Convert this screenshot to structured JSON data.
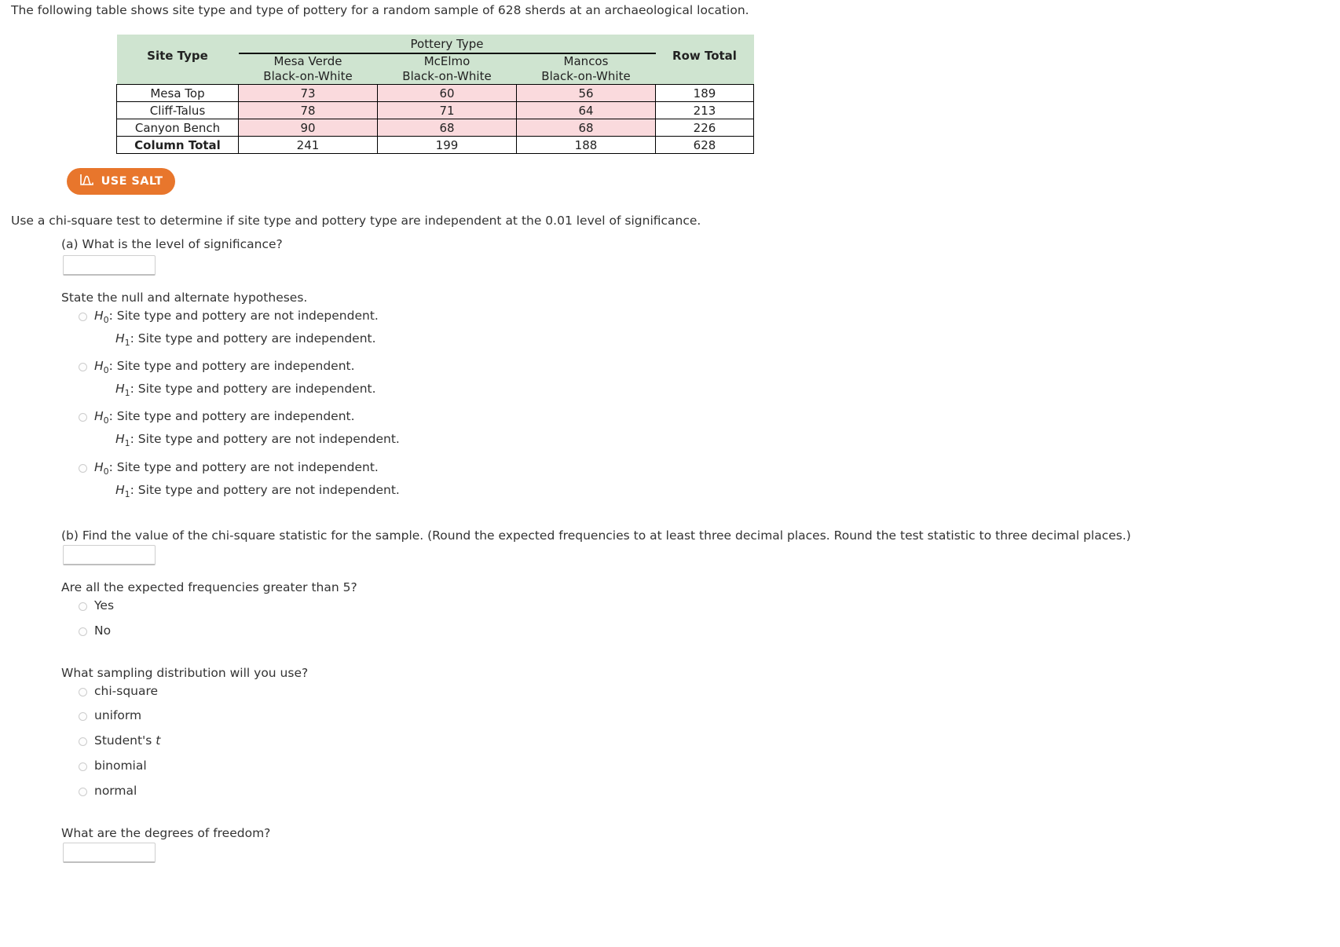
{
  "intro": "The following table shows site type and type of pottery for a random sample of 628 sherds at an archaeological location.",
  "table": {
    "super_header": "Pottery Type",
    "site_type_header": "Site Type",
    "row_total_header": "Row Total",
    "column_headers": [
      {
        "line1": "Mesa Verde",
        "line2": "Black-on-White"
      },
      {
        "line1": "McElmo",
        "line2": "Black-on-White"
      },
      {
        "line1": "Mancos",
        "line2": "Black-on-White"
      }
    ],
    "rows": [
      {
        "label": "Mesa Top",
        "values": [
          "73",
          "60",
          "56"
        ],
        "row_total": "189"
      },
      {
        "label": "Cliff-Talus",
        "values": [
          "78",
          "71",
          "64"
        ],
        "row_total": "213"
      },
      {
        "label": "Canyon Bench",
        "values": [
          "90",
          "68",
          "68"
        ],
        "row_total": "226"
      }
    ],
    "total_row": {
      "label": "Column Total",
      "values": [
        "241",
        "199",
        "188"
      ],
      "row_total": "628"
    }
  },
  "salt_button": {
    "label": "USE SALT",
    "icon": "normal-curve-icon",
    "color": "#e8762c"
  },
  "prompt": "Use a chi-square test to determine if site type and pottery type are independent at the 0.01 level of significance.",
  "part_a": {
    "question": "(a) What is the level of significance?",
    "answer_value": ""
  },
  "hypotheses": {
    "heading": "State the null and alternate hypotheses.",
    "options": [
      {
        "h0_prefix": "H",
        "h0_sub": "0",
        "h0_text": ": Site type and pottery are not independent.",
        "h1_prefix": "H",
        "h1_sub": "1",
        "h1_text": ": Site type and pottery are independent."
      },
      {
        "h0_prefix": "H",
        "h0_sub": "0",
        "h0_text": ": Site type and pottery are independent.",
        "h1_prefix": "H",
        "h1_sub": "1",
        "h1_text": ": Site type and pottery are independent."
      },
      {
        "h0_prefix": "H",
        "h0_sub": "0",
        "h0_text": ": Site type and pottery are independent.",
        "h1_prefix": "H",
        "h1_sub": "1",
        "h1_text": ": Site type and pottery are not independent."
      },
      {
        "h0_prefix": "H",
        "h0_sub": "0",
        "h0_text": ": Site type and pottery are not independent.",
        "h1_prefix": "H",
        "h1_sub": "1",
        "h1_text": ": Site type and pottery are not independent."
      }
    ]
  },
  "part_b": {
    "question": "(b) Find the value of the chi-square statistic for the sample. (Round the expected frequencies to at least three decimal places. Round the test statistic to three decimal places.)",
    "answer_value": ""
  },
  "expected_freq": {
    "question": "Are all the expected frequencies greater than 5?",
    "options": [
      "Yes",
      "No"
    ]
  },
  "sampling_distribution": {
    "question": "What sampling distribution will you use?",
    "options": [
      "chi-square",
      "uniform",
      "Student's t",
      "binomial",
      "normal"
    ],
    "italic_tail_index": 2
  },
  "degrees_of_freedom": {
    "question": "What are the degrees of freedom?",
    "answer_value": ""
  }
}
